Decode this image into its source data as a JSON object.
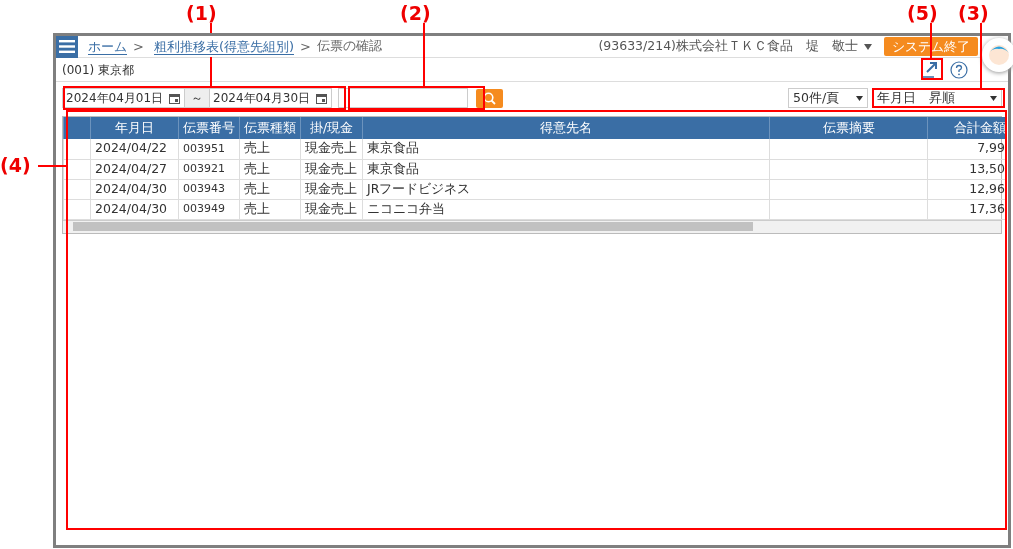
{
  "header": {
    "breadcrumbs": [
      {
        "label": "ホーム"
      },
      {
        "label": "粗利推移表(得意先組別)"
      }
    ],
    "separator": ">",
    "current": "伝票の確認",
    "user": "(93633/214)株式会社ＴＫＣ食品　堤　敬士",
    "exit_button": "システム終了"
  },
  "office": "(001) 東京都",
  "filters": {
    "date_from": "2024年04月01日",
    "range_mark": "～",
    "date_to": "2024年04月30日",
    "page_size": "50件/頁",
    "sort": "年月日　昇順"
  },
  "table": {
    "columns": [
      "年月日",
      "伝票番号",
      "伝票種類",
      "掛/現金",
      "得意先名",
      "伝票摘要",
      "合計金額"
    ],
    "rows": [
      [
        "2024/04/22",
        "003951",
        "売上",
        "現金売上",
        "東京食品",
        "",
        "7,99"
      ],
      [
        "2024/04/27",
        "003921",
        "売上",
        "現金売上",
        "東京食品",
        "",
        "13,50"
      ],
      [
        "2024/04/30",
        "003943",
        "売上",
        "現金売上",
        "JRフードビジネス",
        "",
        "12,96"
      ],
      [
        "2024/04/30",
        "003949",
        "売上",
        "現金売上",
        "ニコニコ弁当",
        "",
        "17,36"
      ]
    ]
  },
  "annotations": [
    {
      "label": "(1)"
    },
    {
      "label": "(2)"
    },
    {
      "label": "(5)"
    },
    {
      "label": "(3)"
    },
    {
      "label": "(4)"
    }
  ]
}
